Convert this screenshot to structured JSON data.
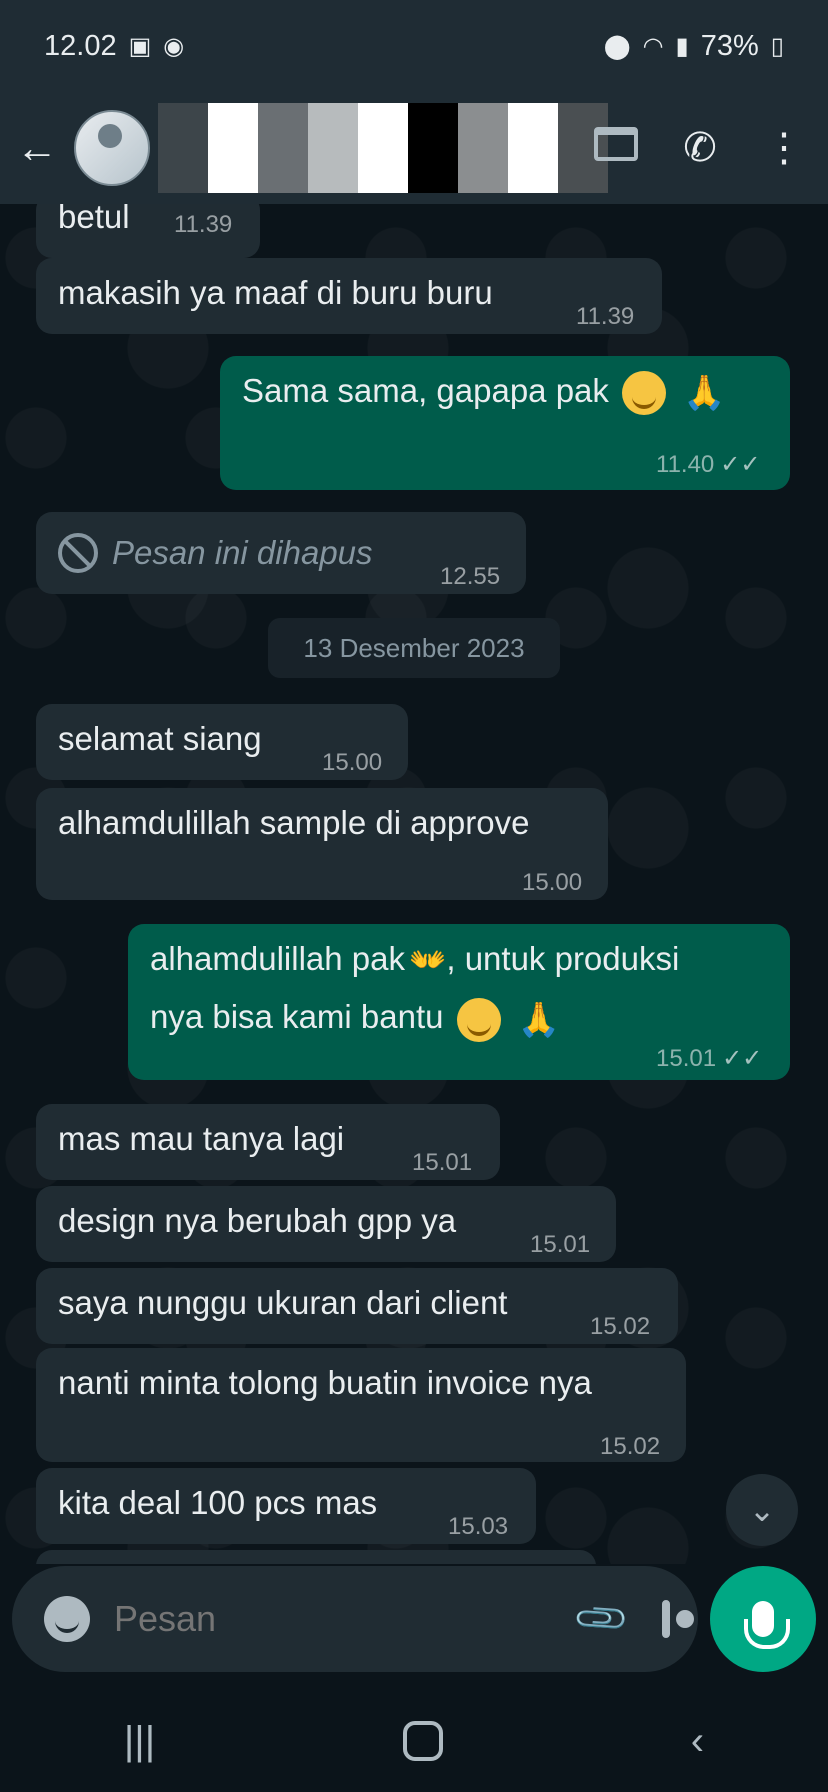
{
  "status_bar": {
    "time": "12.02",
    "battery": "73%"
  },
  "header": {
    "back_icon": "arrow-left-icon",
    "contact_name": "",
    "actions": [
      "shop-icon",
      "add-call-icon",
      "more-vert-icon"
    ]
  },
  "messages": [
    {
      "type": "in",
      "text": "betul",
      "time": "11.39"
    },
    {
      "type": "in",
      "text": "makasih ya maaf di buru buru",
      "time": "11.39"
    },
    {
      "type": "out",
      "text": "Sama sama, gapapa pak",
      "time": "11.40"
    },
    {
      "type": "deleted",
      "text": "Pesan ini dihapus",
      "time": "12.55"
    },
    {
      "type": "in",
      "text": "selamat siang",
      "time": "15.00"
    },
    {
      "type": "in",
      "text": "alhamdulillah sample di approve",
      "time": "15.00"
    },
    {
      "type": "out",
      "text_line1_a": "alhamdulillah pak",
      "text_line1_b": ", untuk produksi",
      "text_line2": "nya bisa kami bantu",
      "time": "15.01"
    },
    {
      "type": "in",
      "text": "mas mau tanya lagi",
      "time": "15.01"
    },
    {
      "type": "in",
      "text": "design nya berubah gpp ya",
      "time": "15.01"
    },
    {
      "type": "in",
      "text": "saya nunggu ukuran dari client",
      "time": "15.02"
    },
    {
      "type": "in",
      "text": "nanti minta tolong buatin invoice nya",
      "time": "15.02"
    },
    {
      "type": "in",
      "text": "kita deal 100 pcs mas",
      "time": "15.03"
    }
  ],
  "date_separator": "13 Desember 2023",
  "composer": {
    "placeholder": "Pesan"
  },
  "colors": {
    "incoming_bubble": "#202c33",
    "outgoing_bubble": "#005c4b",
    "accent": "#00a884",
    "background": "#0b141a"
  }
}
